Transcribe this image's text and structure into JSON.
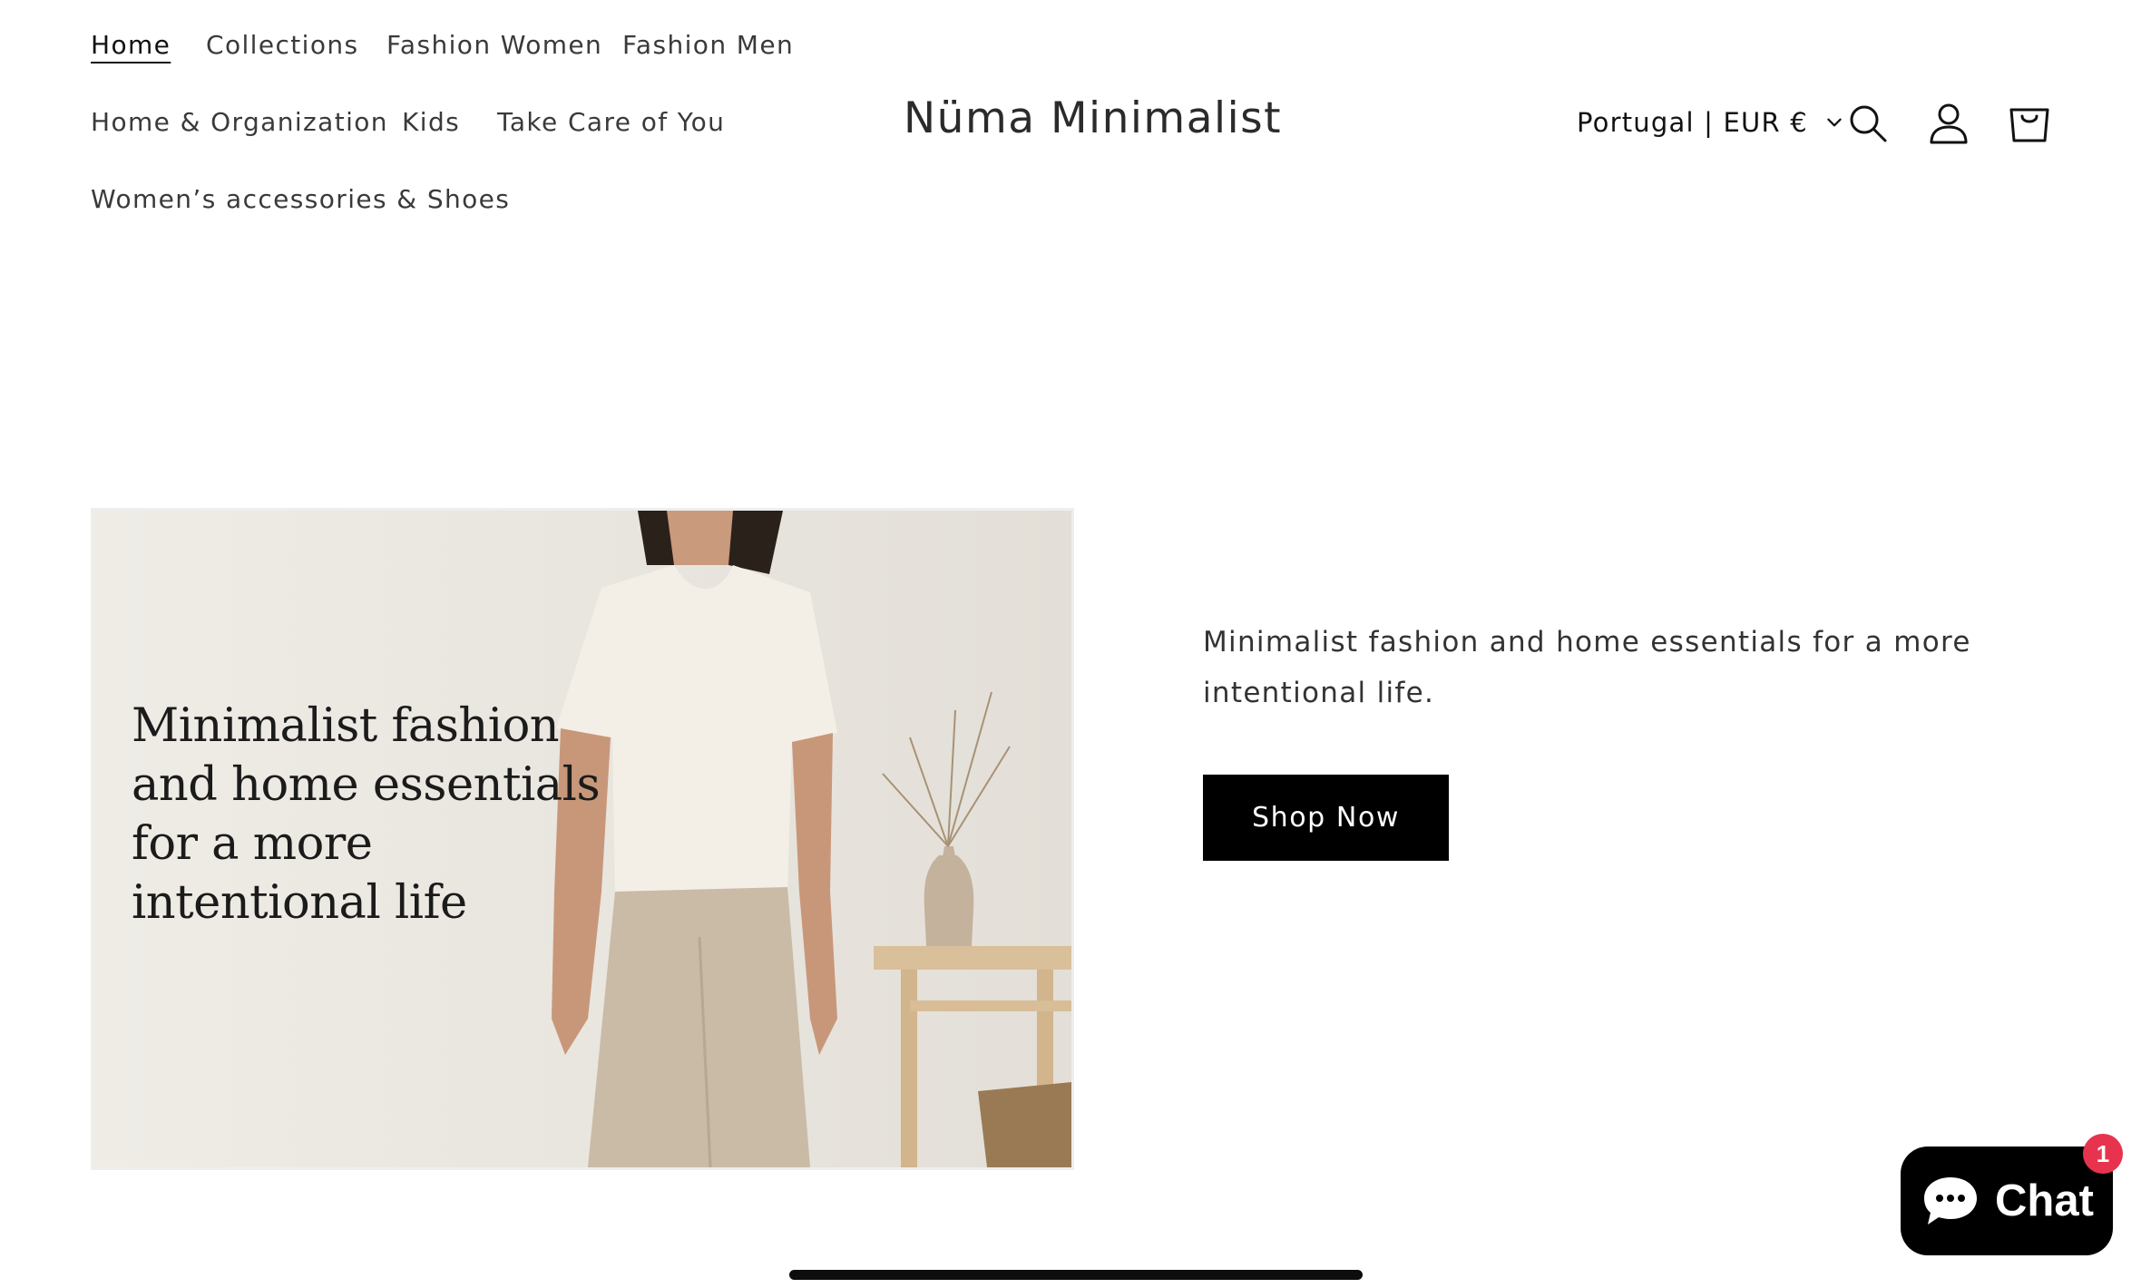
{
  "nav": {
    "items": [
      {
        "label": "Home",
        "active": true
      },
      {
        "label": "Collections"
      },
      {
        "label": "Fashion Women"
      },
      {
        "label": "Fashion Men"
      },
      {
        "label": "Home & Organization"
      },
      {
        "label": "Kids"
      },
      {
        "label": "Take Care of You"
      },
      {
        "label": "Women’s accessories & Shoes"
      }
    ]
  },
  "header": {
    "brand": "Nüma Minimalist",
    "locale": "Portugal | EUR €",
    "icons": [
      "chevron-down-icon",
      "search-icon",
      "account-icon",
      "cart-icon"
    ]
  },
  "hero": {
    "image_heading": "Minimalist fashion and home essentials for a more intentional life",
    "text": "Minimalist fashion and home essentials for a more intentional life.",
    "cta_label": "Shop Now"
  },
  "chat": {
    "label": "Chat",
    "badge": "1",
    "icon": "chat-bubble-icon"
  },
  "colors": {
    "primary_button": "#000000",
    "badge": "#e8334f",
    "text": "#222222",
    "background": "#ffffff"
  }
}
